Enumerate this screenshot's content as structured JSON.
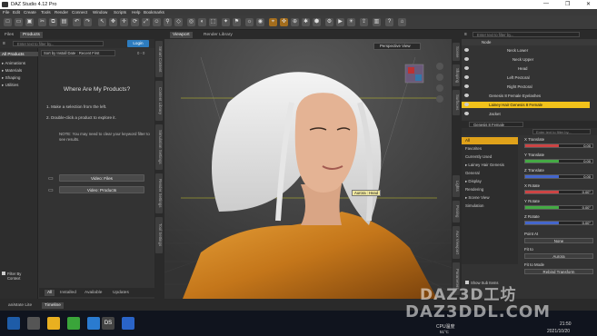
{
  "window": {
    "title": "DAZ Studio 4.12 Pro",
    "controls": [
      "—",
      "❐",
      "✕"
    ]
  },
  "menu": [
    "File",
    "Edit",
    "Create",
    "Tools",
    "Render",
    "Connect",
    "Window",
    "Scripts",
    "Help",
    "Bookmarks"
  ],
  "left_panel": {
    "tabs": [
      "Files",
      "Products"
    ],
    "login_label": "Login",
    "search_placeholder": "Enter text to filter by...",
    "sort_label": "Sort by Install Date : Recent First",
    "page_counter": "0 - 0",
    "categories": [
      {
        "label": "All Products",
        "selected": true
      },
      {
        "label": "▸ Animations",
        "selected": false
      },
      {
        "label": "▸ Materials",
        "selected": false
      },
      {
        "label": "▸ Shaping",
        "selected": false
      },
      {
        "label": "▸ Utilities",
        "selected": false
      }
    ],
    "help_title": "Where Are My Products?",
    "help_step1": "1. Make a selection from the left.",
    "help_step2": "2. Double-click a product to explore it.",
    "help_note": "NOTE: You may need to clear your keyword filter to see results.",
    "video_files_label": "Video: Files",
    "video_products_label": "Video: Products",
    "filter_label": "Filter By Context",
    "bottom_tabs": [
      "All",
      "Installed",
      "Available",
      "Updates"
    ],
    "vertical_tabs": [
      "Smart Content",
      "Content Library",
      "Simulation Settings",
      "Render Settings",
      "Tool Settings"
    ]
  },
  "viewport": {
    "tabs": [
      "Viewport",
      "Render Library"
    ],
    "camera_label": "Perspective View",
    "tooltip_label": "Aurora : Head"
  },
  "right_panel": {
    "search_placeholder": "Enter text to filter by...",
    "scene_header": "Node",
    "scene_items": [
      {
        "label": "Neck Lower",
        "indent": 50,
        "highlight": false
      },
      {
        "label": "Neck Upper",
        "indent": 56,
        "highlight": false
      },
      {
        "label": "Head",
        "indent": 62,
        "highlight": false
      },
      {
        "label": "Left Pectoral",
        "indent": 50,
        "highlight": false
      },
      {
        "label": "Right Pectoral",
        "indent": 50,
        "highlight": false
      },
      {
        "label": "Genesis 8 Female Eyelashes",
        "indent": 30,
        "highlight": false
      },
      {
        "label": "Lainey Hair Genesis 8 Female",
        "indent": 30,
        "highlight": true
      },
      {
        "label": "Jacket",
        "indent": 30,
        "highlight": false
      }
    ],
    "figure_selector": "Genesis 8 Female",
    "params_search_placeholder": "Enter text to filter by...",
    "param_groups": [
      {
        "label": "All",
        "selected": true
      },
      {
        "label": "Favorites",
        "selected": false
      },
      {
        "label": "Currently Used",
        "selected": false
      },
      {
        "label": "▸ Lainey Hair Genesis",
        "selected": false
      },
      {
        "label": "General",
        "selected": false
      },
      {
        "label": "▸ Display",
        "selected": false
      },
      {
        "label": "Rendering",
        "selected": false
      },
      {
        "label": "▸ Scene View",
        "selected": false
      },
      {
        "label": "Simulation",
        "selected": false
      }
    ],
    "params": [
      {
        "label": "X Translate",
        "value": "0.00",
        "fill": 0.5,
        "color": "#c44"
      },
      {
        "label": "Y Translate",
        "value": "0.00",
        "fill": 0.5,
        "color": "#4a4"
      },
      {
        "label": "Z Translate",
        "value": "0.00",
        "fill": 0.5,
        "color": "#46c"
      },
      {
        "label": "X Rotate",
        "value": "0.00°",
        "fill": 0.5,
        "color": "#c44"
      },
      {
        "label": "Y Rotate",
        "value": "0.00°",
        "fill": 0.5,
        "color": "#4a4"
      },
      {
        "label": "Z Rotate",
        "value": "0.00°",
        "fill": 0.5,
        "color": "#46c"
      }
    ],
    "point_at_label": "Point At",
    "point_at_value": "None",
    "fit_label": "Fit to",
    "fit_value": "Aurora",
    "fit_mode_label": "Fit to Mode",
    "fit_mode_value": "Rebind Transform",
    "show_sub_items": "Show Sub Items",
    "vertical_tabs": [
      "Scene",
      "Shaping",
      "Surfaces",
      "Lights",
      "Posing",
      "Aux Viewport",
      "Parameters"
    ]
  },
  "bottom_bar": {
    "tabs": [
      "aniMate Lite",
      "Timeline"
    ]
  },
  "taskbar": {
    "cpu_label": "CPU温度",
    "cpu_value": "51°C",
    "time": "21:50",
    "date": "2021/10/20",
    "weekday": "周三"
  },
  "watermark": {
    "line1": "DAZ3D工坊",
    "line2": "DAZ3DDL.COM"
  }
}
